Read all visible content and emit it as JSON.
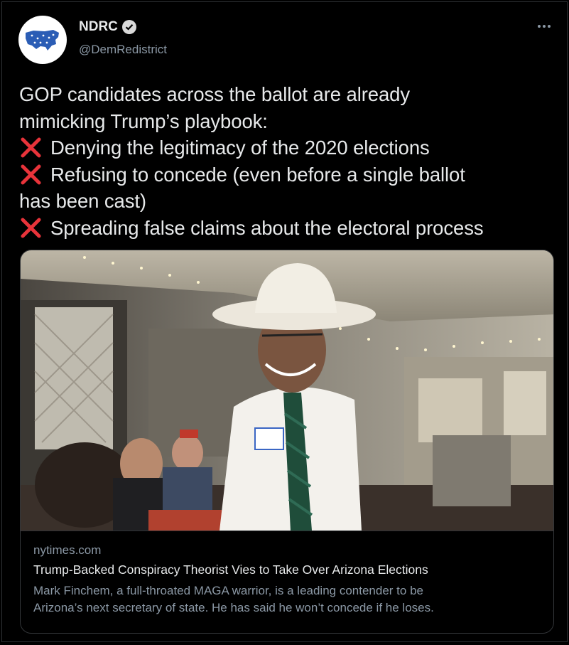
{
  "author": {
    "name": "NDRC",
    "handle": "@DemRedistrict",
    "avatar_icon": "us-map-logo-icon",
    "verified_icon": "verified-badge-icon"
  },
  "menu": {
    "icon": "more-options-icon"
  },
  "tweet": {
    "lines": [
      "GOP candidates across the ballot are already",
      "mimicking Trump’s playbook:",
      "Denying the legitimacy of the 2020 elections",
      "Refusing to concede (even before a single ballot",
      "has been cast)",
      "Spreading false claims about the electoral process"
    ],
    "bullet_icon": "red-x-icon",
    "bullet_color": "#e8333a"
  },
  "card": {
    "image_icon": "photo-man-in-cowboy-hat",
    "domain": "nytimes.com",
    "title": "Trump-Backed Conspiracy Theorist Vies to Take Over Arizona Elections",
    "description": [
      "Mark Finchem, a full-throated MAGA warrior, is a leading contender to be",
      "Arizona’s next secretary of state. He has said he won’t concede if he loses."
    ]
  },
  "colors": {
    "background": "#000000",
    "text": "#e7e9ea",
    "muted": "#8b98a5",
    "border": "#2f3336"
  }
}
